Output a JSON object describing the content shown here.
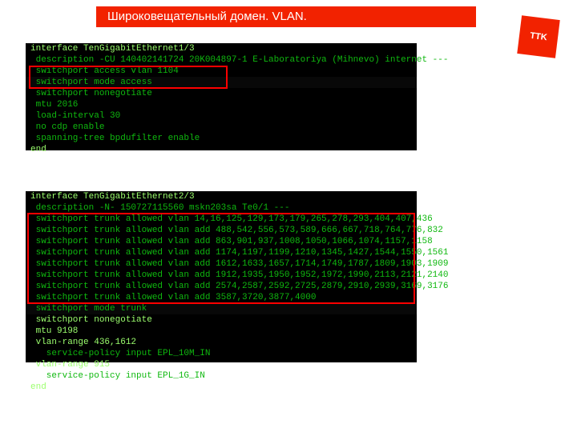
{
  "title": "Широковещательный домен. VLAN.",
  "logo_text": "TTK",
  "terminal1": {
    "l0": "interface TenGigabitEthernet1/3",
    "l1": " description -CU 140402141724 20K004897-1 E-Laboratoriya (Mihnevo) internet ---",
    "l2": " switchport access vlan 1104",
    "l3": " switchport mode access",
    "l4": " switchport nonegotiate",
    "l5": " mtu 2016",
    "l6": " load-interval 30",
    "l7": " no cdp enable",
    "l8": " spanning-tree bpdufilter enable",
    "l9": "end"
  },
  "terminal2": {
    "l0": "interface TenGigabitEthernet2/3",
    "l1": " description -N- 150727115560 mskn203sa Te0/1 ---",
    "l2": " switchport trunk allowed vlan 14,16,125,129,173,179,265,278,293,404,407,436",
    "l3": " switchport trunk allowed vlan add 488,542,556,573,589,666,667,718,764,776,832",
    "l4": " switchport trunk allowed vlan add 863,901,937,1008,1050,1066,1074,1157,1158",
    "l5": " switchport trunk allowed vlan add 1174,1197,1199,1210,1345,1427,1544,1550,1561",
    "l6": " switchport trunk allowed vlan add 1612,1633,1657,1714,1749,1787,1809,1903,1909",
    "l7": " switchport trunk allowed vlan add 1912,1935,1950,1952,1972,1990,2113,2121,2140",
    "l8": " switchport trunk allowed vlan add 2574,2587,2592,2725,2879,2910,2939,3169,3176",
    "l9": " switchport trunk allowed vlan add 3587,3720,3877,4000",
    "l10": " switchport mode trunk",
    "l11": " switchport nonegotiate",
    "l12": " mtu 9198",
    "l13": " vlan-range 436,1612",
    "l14": "   service-policy input EPL_10M_IN",
    "l15": " vlan-range 915",
    "l16": "   service-policy input EPL_1G_IN",
    "l17": "end"
  }
}
